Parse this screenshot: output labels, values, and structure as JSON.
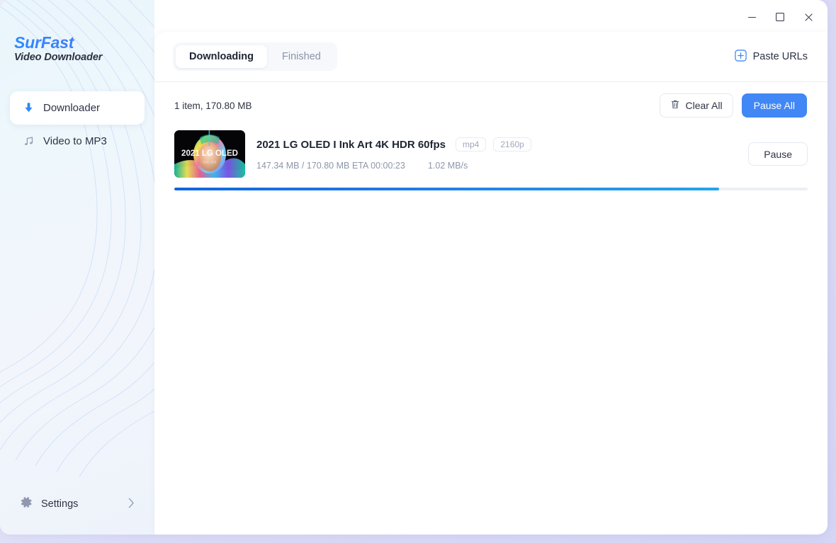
{
  "window": {
    "controls": {
      "minimize": "minimize-icon",
      "maximize": "maximize-icon",
      "close": "close-icon"
    }
  },
  "sidebar": {
    "brand_title": "SurFast",
    "brand_subtitle": "Video Downloader",
    "items": [
      {
        "label": "Downloader",
        "icon": "download-arrow-icon",
        "active": true
      },
      {
        "label": "Video to MP3",
        "icon": "music-note-icon",
        "active": false
      }
    ],
    "settings": {
      "label": "Settings",
      "icon": "gear-icon",
      "chevron": "chevron-right-icon"
    }
  },
  "header": {
    "tabs": [
      {
        "label": "Downloading",
        "active": true
      },
      {
        "label": "Finished",
        "active": false
      }
    ],
    "paste_urls": {
      "label": "Paste URLs",
      "icon": "plus-square-icon"
    }
  },
  "toolbar": {
    "summary": "1 item, 170.80 MB",
    "clear_all_label": "Clear All",
    "clear_all_icon": "trash-icon",
    "pause_all_label": "Pause All"
  },
  "downloads": [
    {
      "title": "2021 LG OLED I  Ink Art 4K HDR 60fps",
      "thumbnail_caption": "2021 LG OLED",
      "thumbnail_subcaption": "Ink Art",
      "format_chip": "mp4",
      "quality_chip": "2160p",
      "downloaded": "147.34 MB / 170.80 MB",
      "eta": "ETA 00:00:23",
      "speed": "1.02 MB/s",
      "action_label": "Pause",
      "progress_percent": 86
    }
  ],
  "colors": {
    "accent_blue": "#4187f5",
    "progress_start": "#0f66e0",
    "progress_end": "#22a3f2",
    "brand_gradient_start": "#2f8bff",
    "brand_gradient_end": "#7b5cf0",
    "window_bg": "#d6d6f6"
  }
}
